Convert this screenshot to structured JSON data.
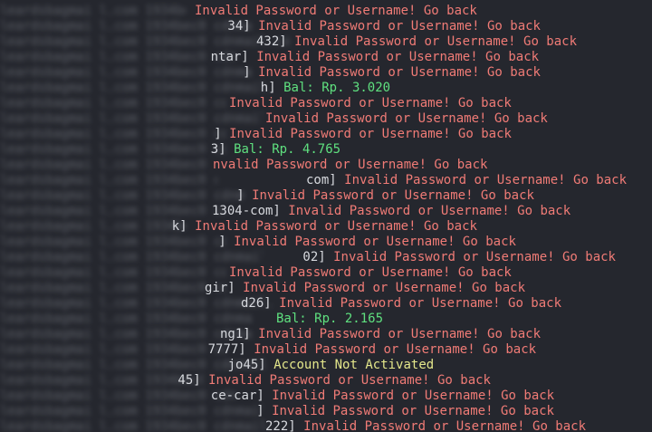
{
  "terminal": {
    "lines": [
      {
        "frag": "",
        "msg": "Invalid Password or Username! Go back",
        "status": "error"
      },
      {
        "frag": "34]",
        "msg": "Invalid Password or Username! Go back",
        "status": "error"
      },
      {
        "frag": "432]",
        "msg": "Invalid Password or Username! Go back",
        "status": "error"
      },
      {
        "frag": "ntar]",
        "msg": "Invalid Password or Username! Go back",
        "status": "error"
      },
      {
        "frag": "]",
        "msg": "Invalid Password or Username! Go back",
        "status": "error"
      },
      {
        "frag": "h]",
        "msg": "Bal: Rp. 3.020",
        "status": "success"
      },
      {
        "frag": "",
        "msg": "Invalid Password or Username! Go back",
        "status": "error"
      },
      {
        "frag": "",
        "msg": "Invalid Password or Username! Go back",
        "status": "error"
      },
      {
        "frag": "]",
        "msg": "Invalid Password or Username! Go back",
        "status": "error"
      },
      {
        "frag": "3]",
        "msg": "Bal: Rp. 4.765",
        "status": "success"
      },
      {
        "frag": "",
        "msg": "nvalid Password or Username! Go back",
        "status": "error"
      },
      {
        "frag": "com]",
        "msg": "Invalid Password or Username! Go back",
        "status": "error"
      },
      {
        "frag": "]",
        "msg": "Invalid Password or Username! Go back",
        "status": "error"
      },
      {
        "frag": "1304-com]",
        "msg": "Invalid Password or Username! Go back",
        "status": "error"
      },
      {
        "frag": "k]",
        "msg": "Invalid Password or Username! Go back",
        "status": "error"
      },
      {
        "frag": "]",
        "msg": "Invalid Password or Username! Go back",
        "status": "error"
      },
      {
        "frag": "02]",
        "msg": "Invalid Password or Username! Go back",
        "status": "error"
      },
      {
        "frag": "",
        "msg": "Invalid Password or Username! Go back",
        "status": "error"
      },
      {
        "frag": "gir]",
        "msg": "Invalid Password or Username! Go back",
        "status": "error"
      },
      {
        "frag": "d26]",
        "msg": "Invalid Password or Username! Go back",
        "status": "error"
      },
      {
        "frag": "",
        "msg": "Bal: Rp. 2.165",
        "status": "success"
      },
      {
        "frag": "ng1]",
        "msg": "Invalid Password or Username! Go back",
        "status": "error"
      },
      {
        "frag": "7777]",
        "msg": "Invalid Password or Username! Go back",
        "status": "error"
      },
      {
        "frag": "jo45]",
        "msg": "Account Not Activated",
        "status": "warning"
      },
      {
        "frag": "45]",
        "msg": "Invalid Password or Username! Go back",
        "status": "error"
      },
      {
        "frag": "ce-car]",
        "msg": "Invalid Password or Username! Go back",
        "status": "error"
      },
      {
        "frag": "]",
        "msg": "Invalid Password or Username! Go back",
        "status": "error"
      },
      {
        "frag": "222]",
        "msg": "Invalid Password or Username! Go back",
        "status": "error"
      }
    ]
  },
  "colors": {
    "background": "#25272e",
    "error": "#f07b76",
    "success": "#5fe07f",
    "warning": "#e4e78b",
    "blurred_text": "#8a8e96"
  }
}
